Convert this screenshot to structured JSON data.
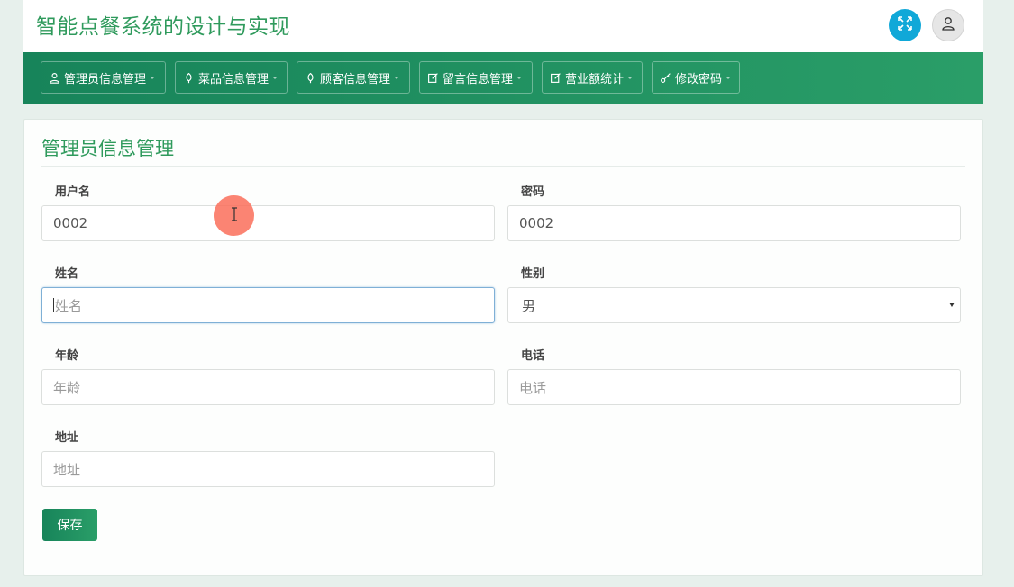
{
  "app": {
    "title": "智能点餐系统的设计与实现"
  },
  "topbar": {
    "fullscreen_icon": "fullscreen-icon",
    "user_icon": "user-icon"
  },
  "nav": {
    "items": [
      {
        "label": "管理员信息管理",
        "icon": "user-icon"
      },
      {
        "label": "菜品信息管理",
        "icon": "leaf-icon"
      },
      {
        "label": "顾客信息管理",
        "icon": "leaf-icon"
      },
      {
        "label": "留言信息管理",
        "icon": "edit-icon"
      },
      {
        "label": "营业额统计",
        "icon": "edit-icon"
      },
      {
        "label": "修改密码",
        "icon": "key-icon"
      }
    ]
  },
  "form": {
    "title": "管理员信息管理",
    "username": {
      "label": "用户名",
      "value": "0002"
    },
    "password": {
      "label": "密码",
      "value": "0002"
    },
    "name": {
      "label": "姓名",
      "placeholder": "姓名"
    },
    "gender": {
      "label": "性别",
      "value": "男"
    },
    "age": {
      "label": "年龄",
      "placeholder": "年龄"
    },
    "phone": {
      "label": "电话",
      "placeholder": "电话"
    },
    "address": {
      "label": "地址",
      "placeholder": "地址"
    },
    "save_label": "保存"
  },
  "colors": {
    "brand": "#2f9a5c",
    "nav_start": "#17845a",
    "nav_end": "#2a9e68",
    "fullscreen": "#10a8d8"
  }
}
